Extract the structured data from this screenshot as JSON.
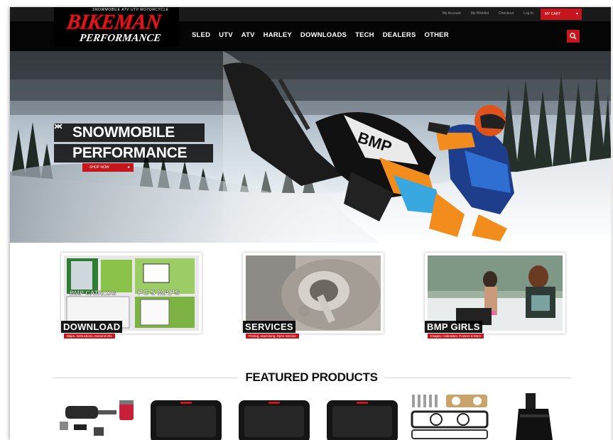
{
  "topbar": {
    "links": [
      "My Account",
      "My Wishlist",
      "Checkout",
      "Log In"
    ],
    "cart_label": "MY CART"
  },
  "logo": {
    "tagline": "SNOWMOBILE ATV UTV MOTORCYCLE",
    "main": "BIKEMAN",
    "sub": "PERFORMANCE"
  },
  "nav": {
    "items": [
      "SLED",
      "UTV",
      "ATV",
      "HARLEY",
      "DOWNLOADS",
      "TECH",
      "DEALERS",
      "OTHER"
    ]
  },
  "hero": {
    "line1": "SNOWMOBILE",
    "line2": "PERFORMANCE",
    "button": "SHOP NOW"
  },
  "tiles": [
    {
      "label": "DOWNLOAD",
      "sub": "Maps, Instructions, General Info"
    },
    {
      "label": "SERVICES",
      "sub": "Porting, Machining, Dyno Service"
    },
    {
      "label": "BMP GIRLS",
      "sub": "Images, Calendars, Posters & More"
    }
  ],
  "featured": {
    "title": "FEATURED PRODUCTS"
  },
  "colors": {
    "accent": "#c4161c",
    "nav_bg": "#050505",
    "topbar_bg": "#1a1a1a"
  }
}
